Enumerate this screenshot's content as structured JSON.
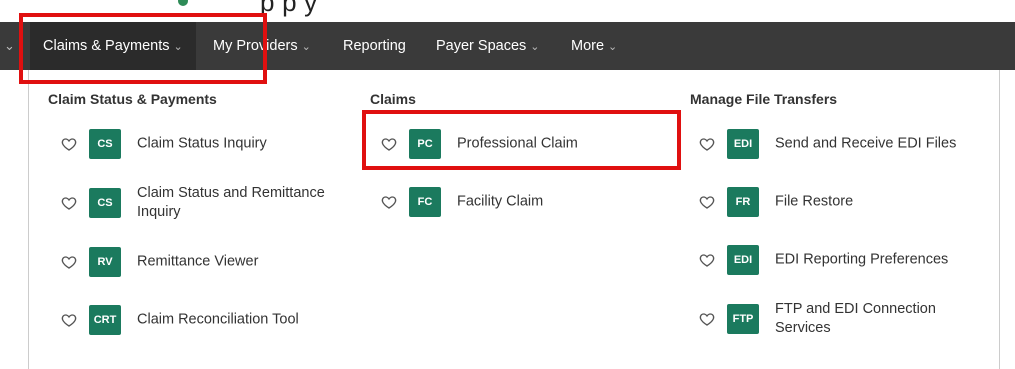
{
  "caption": {
    "text": "p                  p  y"
  },
  "nav": {
    "items": [
      {
        "label": "Claims & Payments",
        "has_chevron": true,
        "active": true
      },
      {
        "label": "My Providers",
        "has_chevron": true
      },
      {
        "label": "Reporting",
        "has_chevron": false
      },
      {
        "label": "Payer Spaces",
        "has_chevron": true
      },
      {
        "label": "More",
        "has_chevron": true
      }
    ]
  },
  "menu": {
    "columns": [
      {
        "heading": "Claim Status & Payments",
        "entries": [
          {
            "badge": "CS",
            "label": "Claim Status Inquiry"
          },
          {
            "badge": "CS",
            "label": "Claim Status and Remittance Inquiry"
          },
          {
            "badge": "RV",
            "label": "Remittance Viewer"
          },
          {
            "badge": "CRT",
            "label": "Claim Reconciliation Tool"
          }
        ]
      },
      {
        "heading": "Claims",
        "entries": [
          {
            "badge": "PC",
            "label": "Professional Claim"
          },
          {
            "badge": "FC",
            "label": "Facility Claim"
          }
        ]
      },
      {
        "heading": "Manage File Transfers",
        "entries": [
          {
            "badge": "EDI",
            "label": "Send and Receive EDI Files"
          },
          {
            "badge": "FR",
            "label": "File Restore"
          },
          {
            "badge": "EDI",
            "label": "EDI Reporting Preferences"
          },
          {
            "badge": "FTP",
            "label": "FTP and EDI Connection Services"
          }
        ]
      }
    ]
  },
  "colors": {
    "navbar": "#3a3a3a",
    "badge": "#1b7a5e",
    "highlight": "#e01010"
  },
  "icons": {
    "favorite": "heart-outline-icon",
    "dropdown": "chevron-down-icon"
  }
}
